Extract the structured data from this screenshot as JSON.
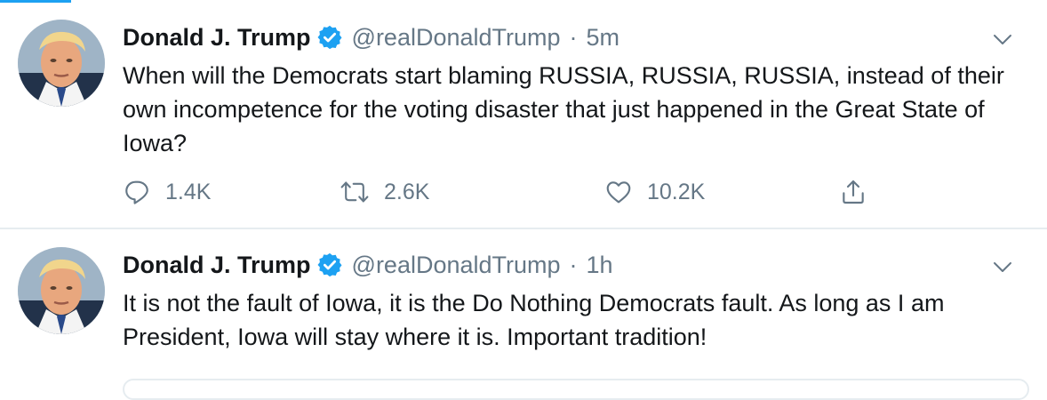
{
  "colors": {
    "accent": "#1da1f2",
    "text": "#14171a",
    "muted": "#657786",
    "divider": "#e6ecf0"
  },
  "tweets": [
    {
      "author": {
        "name": "Donald J. Trump",
        "verified": true,
        "handle": "@realDonaldTrump"
      },
      "separator": "·",
      "time": "5m",
      "text": "When will the Democrats start blaming RUSSIA, RUSSIA, RUSSIA, instead of their own incompetence for the voting disaster that just happened in the Great State of Iowa?",
      "stats": {
        "replies": "1.4K",
        "retweets": "2.6K",
        "likes": "10.2K"
      },
      "icons": [
        "reply-icon",
        "retweet-icon",
        "like-icon",
        "share-icon",
        "chevron-down-icon",
        "verified-badge-icon"
      ]
    },
    {
      "author": {
        "name": "Donald J. Trump",
        "verified": true,
        "handle": "@realDonaldTrump"
      },
      "separator": "·",
      "time": "1h",
      "text": "It is not the fault of Iowa, it is the Do Nothing Democrats fault. As long as I am President, Iowa will stay where it is. Important tradition!",
      "icons": [
        "chevron-down-icon",
        "verified-badge-icon"
      ]
    }
  ]
}
